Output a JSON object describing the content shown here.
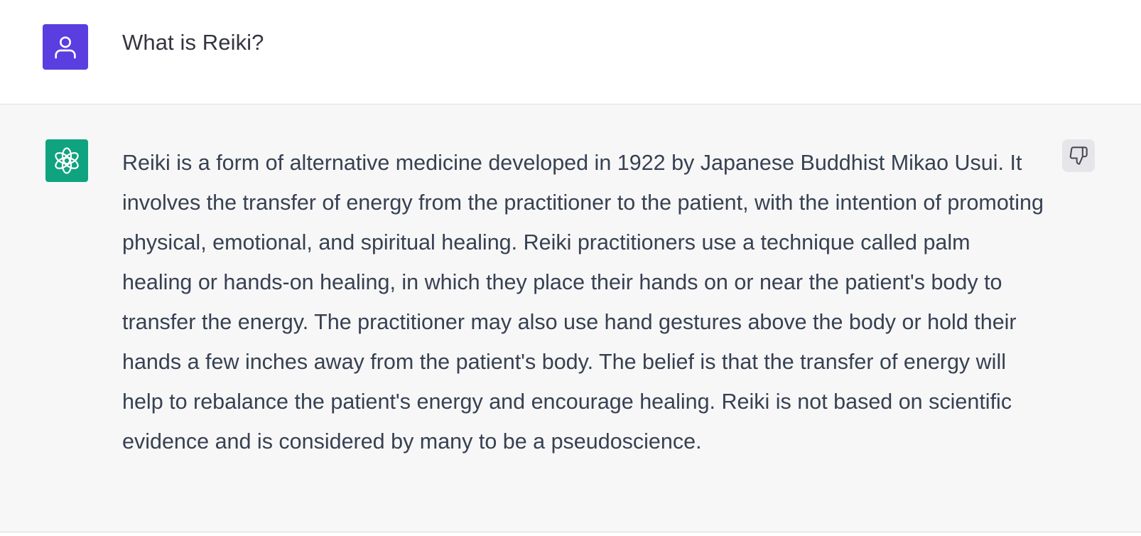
{
  "conversation": {
    "user_message": {
      "avatar_icon": "user-icon",
      "avatar_color": "#5a3ee0",
      "text": "What is Reiki?"
    },
    "assistant_message": {
      "avatar_icon": "openai-logo-icon",
      "avatar_color": "#10a37f",
      "text": "Reiki is a form of alternative medicine developed in 1922 by Japanese Buddhist Mikao Usui. It involves the transfer of energy from the practitioner to the patient, with the intention of promoting physical, emotional, and spiritual healing. Reiki practitioners use a technique called palm healing or hands-on healing, in which they place their hands on or near the patient's body to transfer the energy. The practitioner may also use hand gestures above the body or hold their hands a few inches away from the patient's body. The belief is that the transfer of energy will help to rebalance the patient's energy and encourage healing. Reiki is not based on scientific evidence and is considered by many to be a pseudoscience.",
      "feedback_icon": "thumbs-down-icon"
    }
  }
}
